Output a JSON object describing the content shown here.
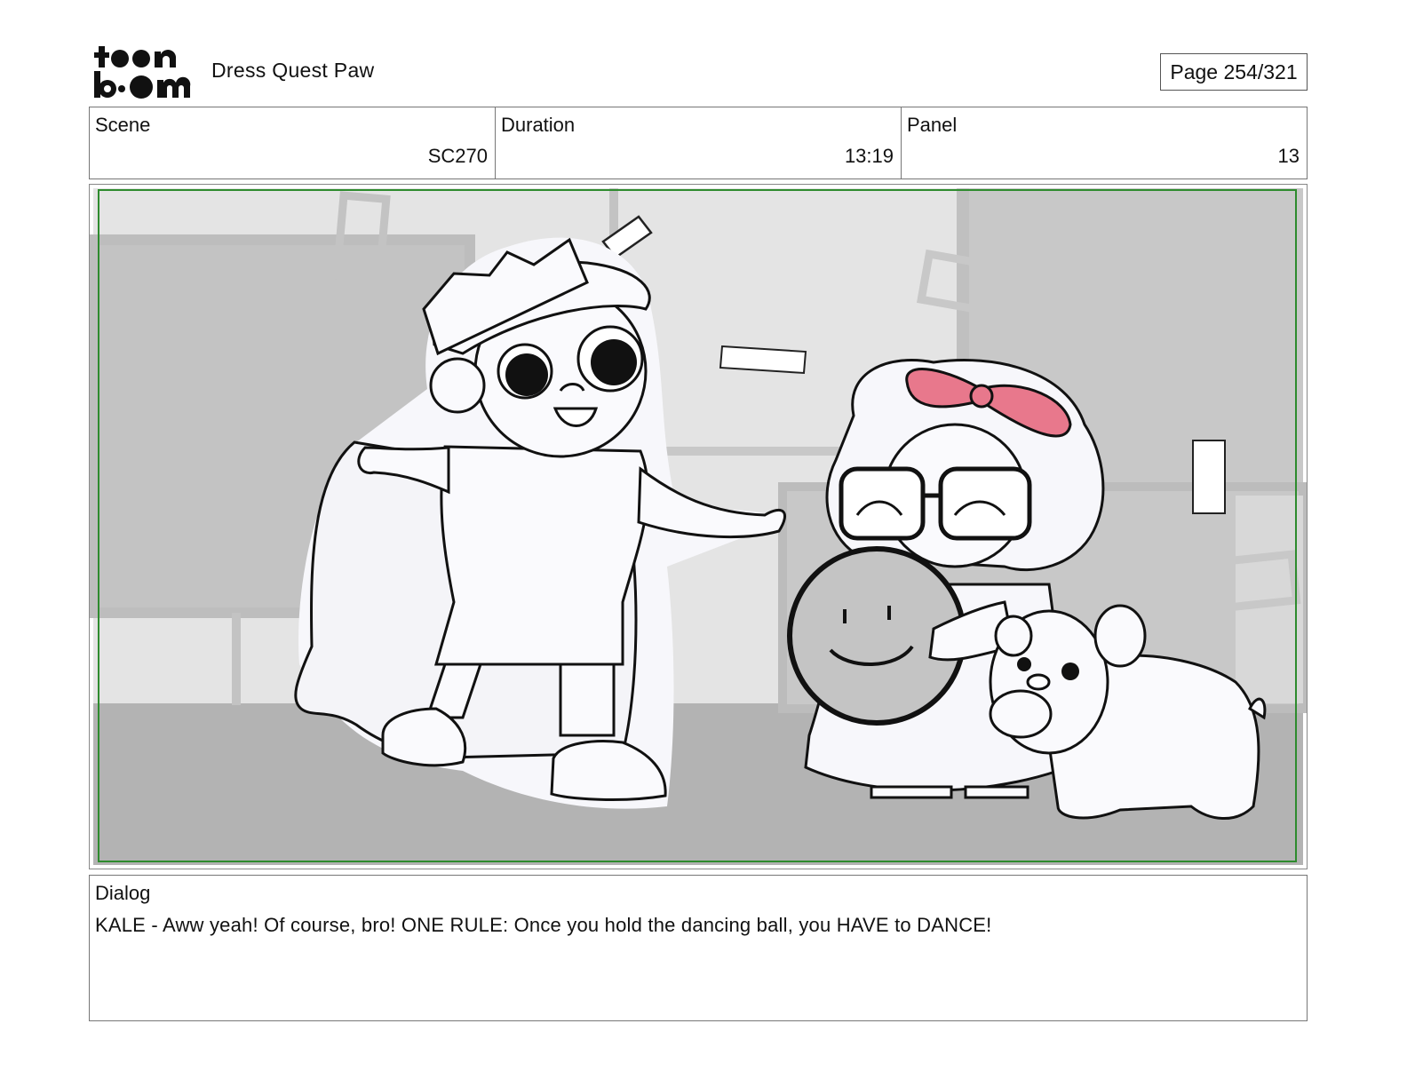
{
  "header": {
    "logo_text_top": "toon",
    "logo_text_bottom": "boom",
    "project_title": "Dress Quest Paw",
    "page_indicator": "Page 254/321"
  },
  "info": {
    "scene": {
      "label": "Scene",
      "value": "SC270"
    },
    "duration": {
      "label": "Duration",
      "value": "13:19"
    },
    "panel": {
      "label": "Panel",
      "value": "13"
    }
  },
  "storyboard": {
    "safe_frame_color": "#2e8b2e",
    "bow_color": "#e8788c",
    "wall_color": "#e4e4e4",
    "floor_color": "#b3b3b3"
  },
  "dialog": {
    "label": "Dialog",
    "text": "KALE - Aww yeah! Of course, bro! ONE RULE: Once you hold the dancing ball, you HAVE to DANCE!"
  }
}
